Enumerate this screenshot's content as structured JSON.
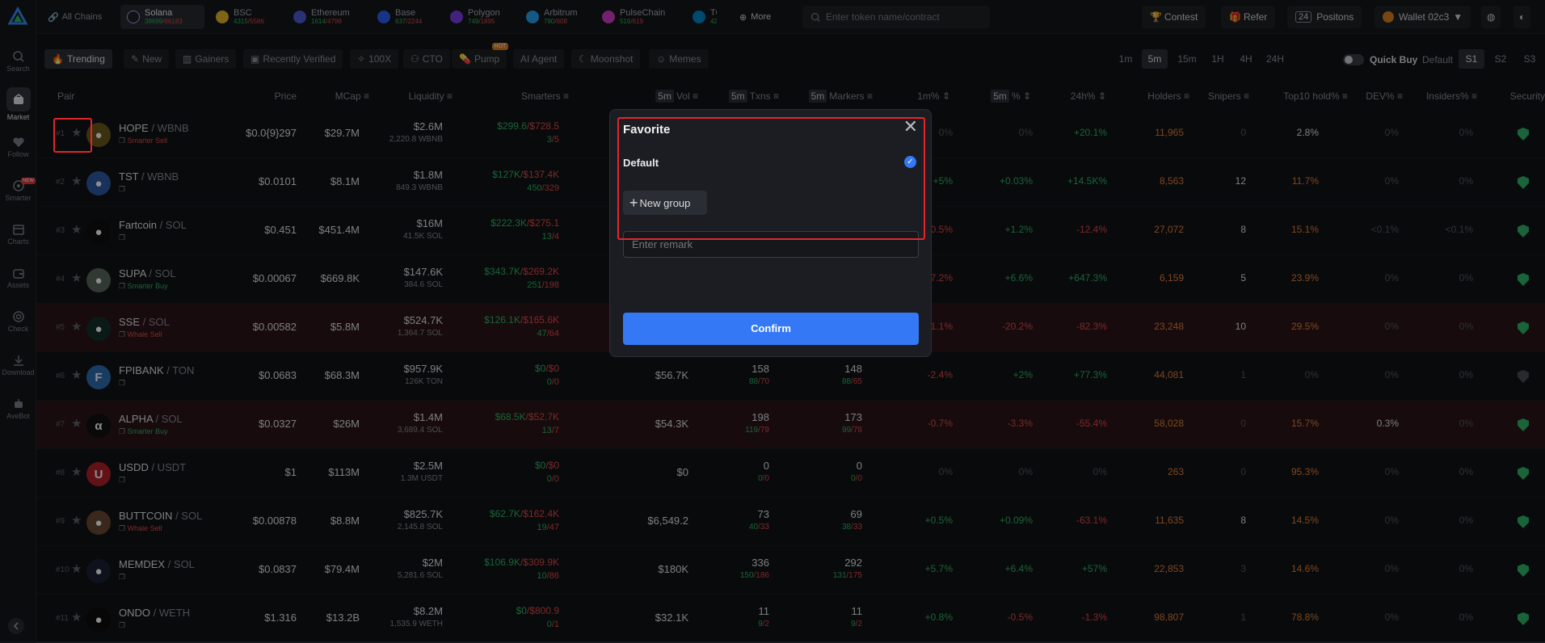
{
  "sidebar": {
    "items": [
      {
        "label": "Search"
      },
      {
        "label": "Market"
      },
      {
        "label": "Follow"
      },
      {
        "label": "Smarter",
        "badge": "NEW"
      },
      {
        "label": "Charts"
      },
      {
        "label": "Assets"
      },
      {
        "label": "Check"
      },
      {
        "label": "Download"
      },
      {
        "label": "AveBot"
      }
    ]
  },
  "topbar": {
    "all_chains": "All Chains",
    "chains": [
      {
        "name": "Solana",
        "up": "38699",
        "down": "/66183"
      },
      {
        "name": "BSC",
        "up": "4315",
        "down": "/5586"
      },
      {
        "name": "Ethereum",
        "up": "1614",
        "down": "/4798"
      },
      {
        "name": "Base",
        "up": "637",
        "down": "/2244"
      },
      {
        "name": "Polygon",
        "up": "749",
        "down": "/1895"
      },
      {
        "name": "Arbitrum",
        "up": "780",
        "down": "/608"
      },
      {
        "name": "PulseChain",
        "up": "516",
        "down": "/619"
      },
      {
        "name": "TO",
        "up": "42",
        "down": ""
      }
    ],
    "more": "More",
    "search_placeholder": "Enter token name/contract",
    "contest": "Contest",
    "refer": "Refer",
    "positions_count": "24",
    "positions": "Positons",
    "wallet": "Wallet 02c3"
  },
  "filters": {
    "tabs": [
      "Trending",
      "New",
      "Gainers",
      "Recently Verified",
      "100X",
      "CTO",
      "Pump",
      "AI Agent",
      "Moonshot",
      "Memes"
    ],
    "hot_badge": "HOT",
    "timeframes": [
      "1m",
      "5m",
      "15m",
      "1H",
      "4H",
      "24H"
    ],
    "quick_buy": "Quick Buy",
    "default": "Default",
    "slots": [
      "S1",
      "S2",
      "S3"
    ]
  },
  "table": {
    "headers": {
      "pair": "Pair",
      "price": "Price",
      "mcap": "MCap",
      "liquidity": "Liquidity",
      "smarters": "Smarters",
      "vol_tag": "5m",
      "vol": "Vol",
      "txns_tag": "5m",
      "txns": "Txns",
      "makers_tag": "5m",
      "makers": "Markers",
      "m1": "1m%",
      "m5_tag": "5m",
      "m5": "%",
      "h24": "24h%",
      "holders": "Holders",
      "snipers": "Snipers",
      "top10": "Top10 hold%",
      "dev": "DEV%",
      "insiders": "Insiders%",
      "security": "Security"
    },
    "rows": [
      {
        "rank": "#1",
        "base": "HOPE",
        "quote": " / WBNB",
        "tag": "Smarter Sell",
        "tagc": "r",
        "av": "●",
        "avc": "#6d5a1c",
        "price": "$0.0{9}297",
        "mcap": "$29.7M",
        "liq1": "$2.6M",
        "liq2": "2,220.8 WBNB",
        "sm_a": "$299.6",
        "sm_b": "/$728.5",
        "sm_c": "3",
        "sm_d": "/5",
        "vol": "",
        "tx1": "",
        "tx2a": "",
        "tx2b": "",
        "mk1": "",
        "mk2a": "",
        "mk2b": "",
        "m1": "0%",
        "m1c": "dim",
        "m5": "0%",
        "m5c": "dim",
        "h24": "+20.1%",
        "h24c": "g",
        "holders": "11,965",
        "snipers": "0",
        "snc": "dim",
        "top10": "2.8%",
        "t10c": "w",
        "dev": "0%",
        "devc": "dim",
        "ins": "0%",
        "insc": "dim",
        "shield": "g",
        "red": false
      },
      {
        "rank": "#2",
        "base": "TST",
        "quote": " / WBNB",
        "tag": "",
        "tagc": "",
        "av": "●",
        "avc": "#2d5ba8",
        "price": "$0.0101",
        "mcap": "$8.1M",
        "liq1": "$1.8M",
        "liq2": "849.3 WBNB",
        "sm_a": "$127K",
        "sm_b": "/$137.4K",
        "sm_c": "450",
        "sm_d": "/329",
        "vol": "",
        "tx1": "",
        "tx2a": "",
        "tx2b": "",
        "mk1": "",
        "mk2a": "",
        "mk2b": "",
        "m1": "+5%",
        "m1c": "g",
        "m5": "+0.03%",
        "m5c": "g",
        "h24": "+14.5K%",
        "h24c": "g",
        "holders": "8,563",
        "snipers": "12",
        "snc": "w",
        "top10": "11.7%",
        "t10c": "o",
        "dev": "0%",
        "devc": "dim",
        "ins": "0%",
        "insc": "dim",
        "shield": "g",
        "red": false
      },
      {
        "rank": "#3",
        "base": "Fartcoin",
        "quote": " / SOL",
        "tag": "",
        "tagc": "",
        "av": "●",
        "avc": "#101010",
        "price": "$0.451",
        "mcap": "$451.4M",
        "liq1": "$16M",
        "liq2": "41.5K SOL",
        "sm_a": "$222.3K",
        "sm_b": "/$275.1",
        "sm_c": "13",
        "sm_d": "/4",
        "vol": "",
        "tx1": "",
        "tx2a": "",
        "tx2b": "",
        "mk1": "",
        "mk2a": "",
        "mk2b": "",
        "m1": "0.5%",
        "m1c": "r",
        "m5": "+1.2%",
        "m5c": "g",
        "h24": "-12.4%",
        "h24c": "r",
        "holders": "27,072",
        "snipers": "8",
        "snc": "w",
        "top10": "15.1%",
        "t10c": "o",
        "dev": "<0.1%",
        "devc": "dim",
        "ins": "<0.1%",
        "insc": "dim",
        "shield": "g",
        "red": false
      },
      {
        "rank": "#4",
        "base": "SUPA",
        "quote": " / SOL",
        "tag": "Smarter Buy",
        "tagc": "g",
        "av": "●",
        "avc": "#5a6b5c",
        "price": "$0.00067",
        "mcap": "$669.8K",
        "liq1": "$147.6K",
        "liq2": "384.6 SOL",
        "sm_a": "$343.7K",
        "sm_b": "/$269.2K",
        "sm_c": "251",
        "sm_d": "/198",
        "vol": "",
        "tx1": "",
        "tx2a": "",
        "tx2b": "",
        "mk1": "",
        "mk2a": "",
        "mk2b": "",
        "m1": "7.2%",
        "m1c": "r",
        "m5": "+6.6%",
        "m5c": "g",
        "h24": "+647.3%",
        "h24c": "g",
        "holders": "6,159",
        "snipers": "5",
        "snc": "w",
        "top10": "23.9%",
        "t10c": "o",
        "dev": "0%",
        "devc": "dim",
        "ins": "0%",
        "insc": "dim",
        "shield": "g",
        "red": false
      },
      {
        "rank": "#5",
        "base": "SSE",
        "quote": " / SOL",
        "tag": "Whale Sell",
        "tagc": "r",
        "av": "●",
        "avc": "#14302a",
        "price": "$0.00582",
        "mcap": "$5.8M",
        "liq1": "$524.7K",
        "liq2": "1,364.7 SOL",
        "sm_a": "$126.1K",
        "sm_b": "/$165.6K",
        "sm_c": "47",
        "sm_d": "/64",
        "vol": "",
        "tx1": "",
        "tx2a": "",
        "tx2b": "",
        "mk1": "",
        "mk2a": "",
        "mk2b": "",
        "m1": "1.1%",
        "m1c": "r",
        "m5": "-20.2%",
        "m5c": "r",
        "h24": "-82.3%",
        "h24c": "r",
        "holders": "23,248",
        "snipers": "10",
        "snc": "w",
        "top10": "29.5%",
        "t10c": "o",
        "dev": "0%",
        "devc": "dim",
        "ins": "0%",
        "insc": "dim",
        "shield": "g",
        "red": true
      },
      {
        "rank": "#6",
        "base": "FPIBANK",
        "quote": " / TON",
        "tag": "",
        "tagc": "",
        "av": "F",
        "avc": "#2f6fb3",
        "price": "$0.0683",
        "mcap": "$68.3M",
        "liq1": "$957.9K",
        "liq2": "126K TON",
        "sm_a": "$0",
        "sm_b": "/$0",
        "sm_c": "0",
        "sm_d": "/0",
        "vol": "$56.7K",
        "tx1": "158",
        "tx2a": "88",
        "tx2b": "/70",
        "mk1": "148",
        "mk2a": "88",
        "mk2b": "/65",
        "m1": "-2.4%",
        "m1c": "r",
        "m5": "+2%",
        "m5c": "g",
        "h24": "+77.3%",
        "h24c": "g",
        "holders": "44,081",
        "snipers": "1",
        "snc": "dim",
        "top10": "0%",
        "t10c": "dim",
        "dev": "0%",
        "devc": "dim",
        "ins": "0%",
        "insc": "dim",
        "shield": "grey",
        "red": false
      },
      {
        "rank": "#7",
        "base": "ALPHA",
        "quote": " / SOL",
        "tag": "Smarter Buy",
        "tagc": "g",
        "av": "α",
        "avc": "#111111",
        "price": "$0.0327",
        "mcap": "$26M",
        "liq1": "$1.4M",
        "liq2": "3,689.4 SOL",
        "sm_a": "$68.5K",
        "sm_b": "/$52.7K",
        "sm_c": "13",
        "sm_d": "/7",
        "vol": "$54.3K",
        "tx1": "198",
        "tx2a": "119",
        "tx2b": "/79",
        "mk1": "173",
        "mk2a": "99",
        "mk2b": "/78",
        "m1": "-0.7%",
        "m1c": "r",
        "m5": "-3.3%",
        "m5c": "r",
        "h24": "-55.4%",
        "h24c": "r",
        "holders": "58,028",
        "snipers": "0",
        "snc": "dim",
        "top10": "15.7%",
        "t10c": "o",
        "dev": "0.3%",
        "devc": "w",
        "ins": "0%",
        "insc": "dim",
        "shield": "g",
        "red": true
      },
      {
        "rank": "#8",
        "base": "USDD",
        "quote": " / USDT",
        "tag": "",
        "tagc": "",
        "av": "U",
        "avc": "#b3202a",
        "price": "$1",
        "mcap": "$113M",
        "liq1": "$2.5M",
        "liq2": "1.3M USDT",
        "sm_a": "$0",
        "sm_b": "/$0",
        "sm_c": "0",
        "sm_d": "/0",
        "vol": "$0",
        "tx1": "0",
        "tx2a": "0",
        "tx2b": "/0",
        "mk1": "0",
        "mk2a": "0",
        "mk2b": "/0",
        "m1": "0%",
        "m1c": "dim",
        "m5": "0%",
        "m5c": "dim",
        "h24": "0%",
        "h24c": "dim",
        "holders": "263",
        "snipers": "0",
        "snc": "dim",
        "top10": "95.3%",
        "t10c": "o",
        "dev": "0%",
        "devc": "dim",
        "ins": "0%",
        "insc": "dim",
        "shield": "g",
        "red": false
      },
      {
        "rank": "#9",
        "base": "BUTTCOIN",
        "quote": " / SOL",
        "tag": "Whale Sell",
        "tagc": "r",
        "av": "●",
        "avc": "#6a4a36",
        "price": "$0.00878",
        "mcap": "$8.8M",
        "liq1": "$825.7K",
        "liq2": "2,145.8 SOL",
        "sm_a": "$62.7K",
        "sm_b": "/$162.4K",
        "sm_c": "19",
        "sm_d": "/47",
        "vol": "$6,549.2",
        "tx1": "73",
        "tx2a": "40",
        "tx2b": "/33",
        "mk1": "69",
        "mk2a": "38",
        "mk2b": "/33",
        "m1": "+0.5%",
        "m1c": "g",
        "m5": "+0.09%",
        "m5c": "g",
        "h24": "-63.1%",
        "h24c": "r",
        "holders": "11,635",
        "snipers": "8",
        "snc": "w",
        "top10": "14.5%",
        "t10c": "o",
        "dev": "0%",
        "devc": "dim",
        "ins": "0%",
        "insc": "dim",
        "shield": "g",
        "red": false
      },
      {
        "rank": "#10",
        "base": "MEMDEX",
        "quote": " / SOL",
        "tag": "",
        "tagc": "",
        "av": "●",
        "avc": "#1a2233",
        "price": "$0.0837",
        "mcap": "$79.4M",
        "liq1": "$2M",
        "liq2": "5,281.6 SOL",
        "sm_a": "$106.9K",
        "sm_b": "/$309.9K",
        "sm_c": "10",
        "sm_d": "/86",
        "vol": "$180K",
        "tx1": "336",
        "tx2a": "150",
        "tx2b": "/186",
        "mk1": "292",
        "mk2a": "131",
        "mk2b": "/175",
        "m1": "+5.7%",
        "m1c": "g",
        "m5": "+6.4%",
        "m5c": "g",
        "h24": "+57%",
        "h24c": "g",
        "holders": "22,853",
        "snipers": "3",
        "snc": "dim",
        "top10": "14.6%",
        "t10c": "o",
        "dev": "0%",
        "devc": "dim",
        "ins": "0%",
        "insc": "dim",
        "shield": "g",
        "red": false
      },
      {
        "rank": "#11",
        "base": "ONDO",
        "quote": " / WETH",
        "tag": "",
        "tagc": "",
        "av": "●",
        "avc": "#0d0d0d",
        "price": "$1.316",
        "mcap": "$13.2B",
        "liq1": "$8.2M",
        "liq2": "1,535.9 WETH",
        "sm_a": "$0",
        "sm_b": "/$800.9",
        "sm_c": "0",
        "sm_d": "/1",
        "vol": "$32.1K",
        "tx1": "11",
        "tx2a": "9",
        "tx2b": "/2",
        "mk1": "11",
        "mk2a": "9",
        "mk2b": "/2",
        "m1": "+0.8%",
        "m1c": "g",
        "m5": "-0.5%",
        "m5c": "r",
        "h24": "-1.3%",
        "h24c": "r",
        "holders": "98,807",
        "snipers": "1",
        "snc": "dim",
        "top10": "78.8%",
        "t10c": "o",
        "dev": "0%",
        "devc": "dim",
        "ins": "0%",
        "insc": "dim",
        "shield": "g",
        "red": false
      }
    ]
  },
  "modal": {
    "title": "Favorite",
    "close": "✕",
    "default_group": "Default",
    "new_group": "New group",
    "remark_placeholder": "Enter remark",
    "confirm": "Confirm"
  }
}
